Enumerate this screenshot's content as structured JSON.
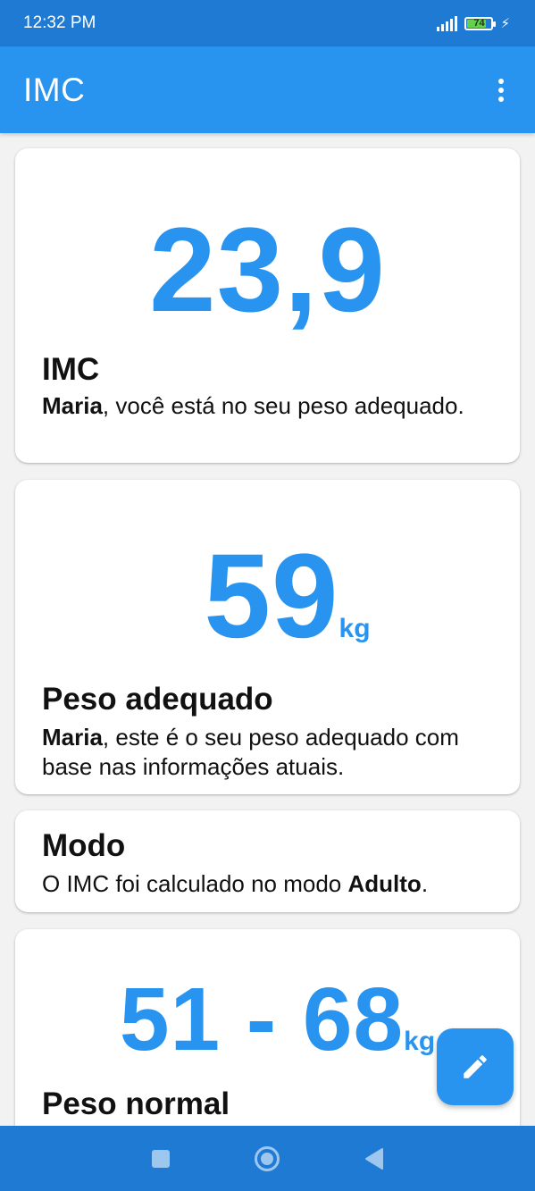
{
  "status_bar": {
    "time": "12:32 PM",
    "battery": "74"
  },
  "app_bar": {
    "title": "IMC"
  },
  "cards": {
    "imc": {
      "value": "23,9",
      "title": "IMC",
      "desc_name": "Maria",
      "desc_text": ", você está no seu peso adequado."
    },
    "ideal_weight": {
      "value": "59",
      "unit": "kg",
      "title": "Peso adequado",
      "desc_name": "Maria",
      "desc_text": ", este é o seu peso adequado com base nas informações atuais."
    },
    "mode": {
      "title": "Modo",
      "desc_prefix": "O IMC foi calculado no modo ",
      "desc_mode": "Adulto",
      "desc_suffix": "."
    },
    "normal_weight": {
      "value": "51 - 68",
      "unit": "kg",
      "title": "Peso normal"
    }
  },
  "colors": {
    "primary": "#2894f0",
    "status_bar": "#1f7ad3",
    "nav_bar": "#1f7ad3"
  },
  "icons": {
    "menu": "more-vert-icon",
    "fab": "pencil-icon",
    "nav": [
      "square-icon",
      "circle-icon",
      "triangle-icon"
    ]
  }
}
